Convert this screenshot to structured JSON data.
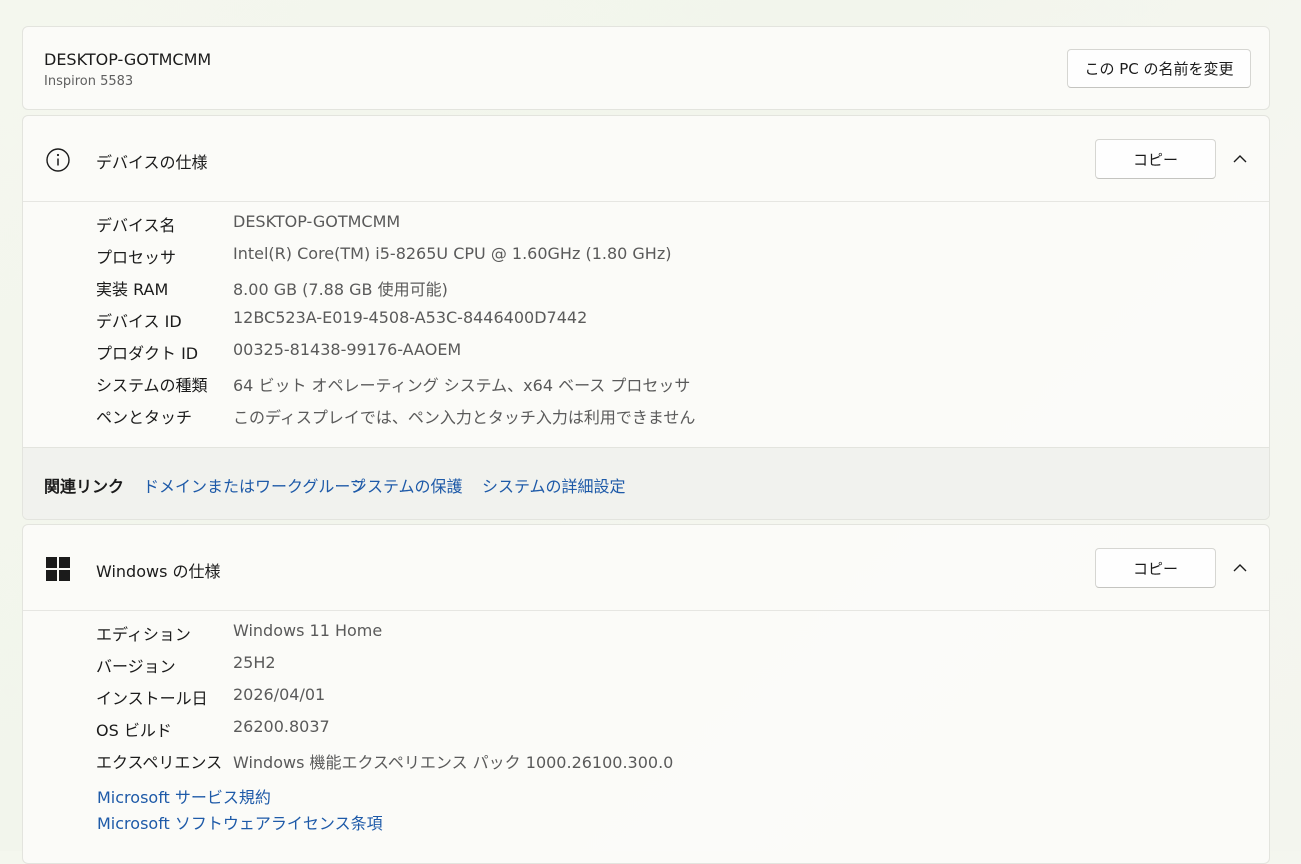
{
  "pc": {
    "name": "DESKTOP-GOTMCMM",
    "model": "Inspiron 5583",
    "rename_label": "この PC の名前を変更"
  },
  "device_specs": {
    "title": "デバイスの仕様",
    "copy_label": "コピー",
    "icon": "info-icon",
    "rows": [
      {
        "label": "デバイス名",
        "value": "DESKTOP-GOTMCMM"
      },
      {
        "label": "プロセッサ",
        "value": "Intel(R) Core(TM) i5-8265U CPU @ 1.60GHz (1.80 GHz)"
      },
      {
        "label": "実装 RAM",
        "value": "8.00 GB (7.88 GB 使用可能)"
      },
      {
        "label": "デバイス ID",
        "value": "12BC523A-E019-4508-A53C-8446400D7442"
      },
      {
        "label": "プロダクト ID",
        "value": "00325-81438-99176-AAOEM"
      },
      {
        "label": "システムの種類",
        "value": "64 ビット オペレーティング システム、x64 ベース プロセッサ"
      },
      {
        "label": "ペンとタッチ",
        "value": "このディスプレイでは、ペン入力とタッチ入力は利用できません"
      }
    ]
  },
  "related": {
    "label": "関連リンク",
    "links": [
      "ドメインまたはワークグループ",
      "システムの保護",
      "システムの詳細設定"
    ]
  },
  "windows_specs": {
    "title": "Windows の仕様",
    "copy_label": "コピー",
    "icon": "windows-logo-icon",
    "rows": [
      {
        "label": "エディション",
        "value": "Windows 11 Home"
      },
      {
        "label": "バージョン",
        "value": "25H2"
      },
      {
        "label": "インストール日",
        "value": "2026/04/01"
      },
      {
        "label": "OS ビルド",
        "value": "26200.8037"
      },
      {
        "label": "エクスペリエンス",
        "value": "Windows 機能エクスペリエンス パック 1000.26100.300.0"
      }
    ],
    "links": [
      "Microsoft サービス規約",
      "Microsoft ソフトウェアライセンス条項"
    ]
  },
  "colors": {
    "link": "#1e5aa8",
    "value_text": "#5a5a5a"
  }
}
